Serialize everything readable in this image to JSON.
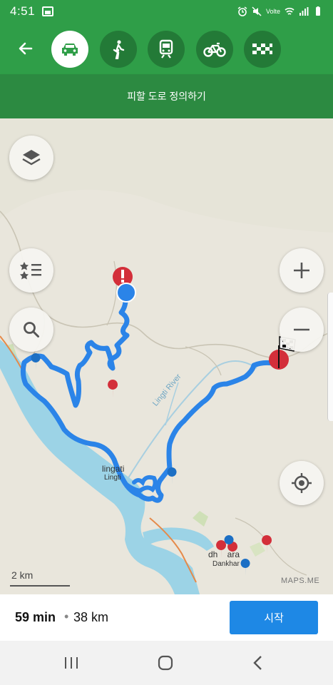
{
  "status_bar": {
    "time": "4:51",
    "network": "Volte"
  },
  "transport": {
    "modes": [
      {
        "icon": "car-icon",
        "active": true
      },
      {
        "icon": "walk-icon",
        "active": false
      },
      {
        "icon": "train-icon",
        "active": false
      },
      {
        "icon": "bicycle-icon",
        "active": false
      },
      {
        "icon": "taxi-icon",
        "active": false
      }
    ]
  },
  "avoid": {
    "label": "피할 도로 정의하기"
  },
  "map": {
    "labels": {
      "river": "Lingti River",
      "town1_local": "lingati",
      "town1": "Lingti",
      "town2_local": "dh    ara",
      "town2": "Dankhar"
    },
    "scale": "2 km",
    "watermark": "MAPS.ME"
  },
  "summary": {
    "time": "59 min",
    "separator": "•",
    "distance": "38 km",
    "start_label": "시작"
  },
  "colors": {
    "primary_green": "#2f9e48",
    "route_blue": "#2b84e8",
    "start_blue": "#1e88e5",
    "pin_red": "#d32f3a",
    "pin_blue": "#1c6fc4"
  }
}
